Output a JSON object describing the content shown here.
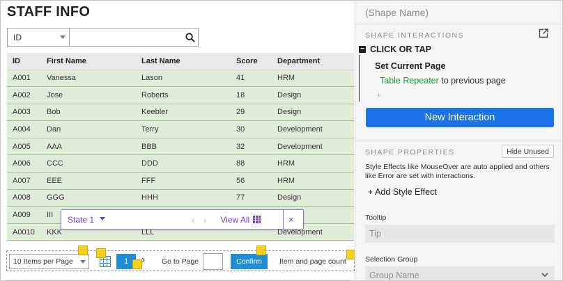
{
  "canvas": {
    "title": "STAFF INFO",
    "search": {
      "field": "ID",
      "value": "",
      "placeholder": ""
    },
    "table": {
      "columns": [
        "ID",
        "First Name",
        "Last Name",
        "Score",
        "Department"
      ],
      "rows": [
        [
          "A001",
          "Vanessa",
          "Lason",
          "41",
          "HRM"
        ],
        [
          "A002",
          "Jose",
          "Roberts",
          "18",
          "Design"
        ],
        [
          "A003",
          "Bob",
          "Keebler",
          "29",
          "Design"
        ],
        [
          "A004",
          "Dan",
          "Terry",
          "30",
          "Development"
        ],
        [
          "A005",
          "AAA",
          "BBB",
          "32",
          "Development"
        ],
        [
          "A006",
          "CCC",
          "DDD",
          "88",
          "HRM"
        ],
        [
          "A007",
          "EEE",
          "FFF",
          "56",
          "HRM"
        ],
        [
          "A008",
          "GGG",
          "HHH",
          "77",
          "Design"
        ],
        [
          "A009",
          "III",
          "",
          "",
          ""
        ],
        [
          "A0010",
          "KKK",
          "LLL",
          "",
          "Development"
        ]
      ]
    },
    "state_bar": {
      "state": "State 1",
      "view_all": "View All",
      "close": "×"
    },
    "pager": {
      "per_page": "10 Items per Page",
      "current_page": "1",
      "goto_label": "Go to Page",
      "goto_value": "",
      "confirm": "Confirm",
      "count_text": "Item and page count"
    }
  },
  "panel": {
    "shape_name": "(Shape Name)",
    "interactions_label": "SHAPE INTERACTIONS",
    "event": "CLICK OR TAP",
    "action": "Set Current Page",
    "action_target": "Table Repeater",
    "action_rest": " to previous page",
    "add_action": "+",
    "new_interaction": "New Interaction",
    "properties_label": "SHAPE PROPERTIES",
    "hide_unused": "Hide Unused",
    "help_text": "Style Effects like MouseOver are auto applied and others like Error are set with interactions.",
    "add_style_effect": "+ Add Style Effect",
    "tooltip_label": "Tooltip",
    "tooltip_placeholder": "Tip",
    "selection_group_label": "Selection Group",
    "selection_group_placeholder": "Group Name"
  },
  "colors": {
    "row_fill": "#e0ecd8",
    "header_fill": "#e9e9e9",
    "accent_blue": "#1a73e8",
    "pager_blue": "#1e8fd6",
    "state_purple": "#6f3ed6",
    "target_green": "#1a9a2a",
    "interaction_bolt": "#f7d21c"
  },
  "icons": [
    "search-icon",
    "external-link-icon",
    "grid-view-icon",
    "lightning-icon",
    "chevron-left-icon",
    "chevron-right-icon",
    "close-icon",
    "chevron-down-icon"
  ]
}
